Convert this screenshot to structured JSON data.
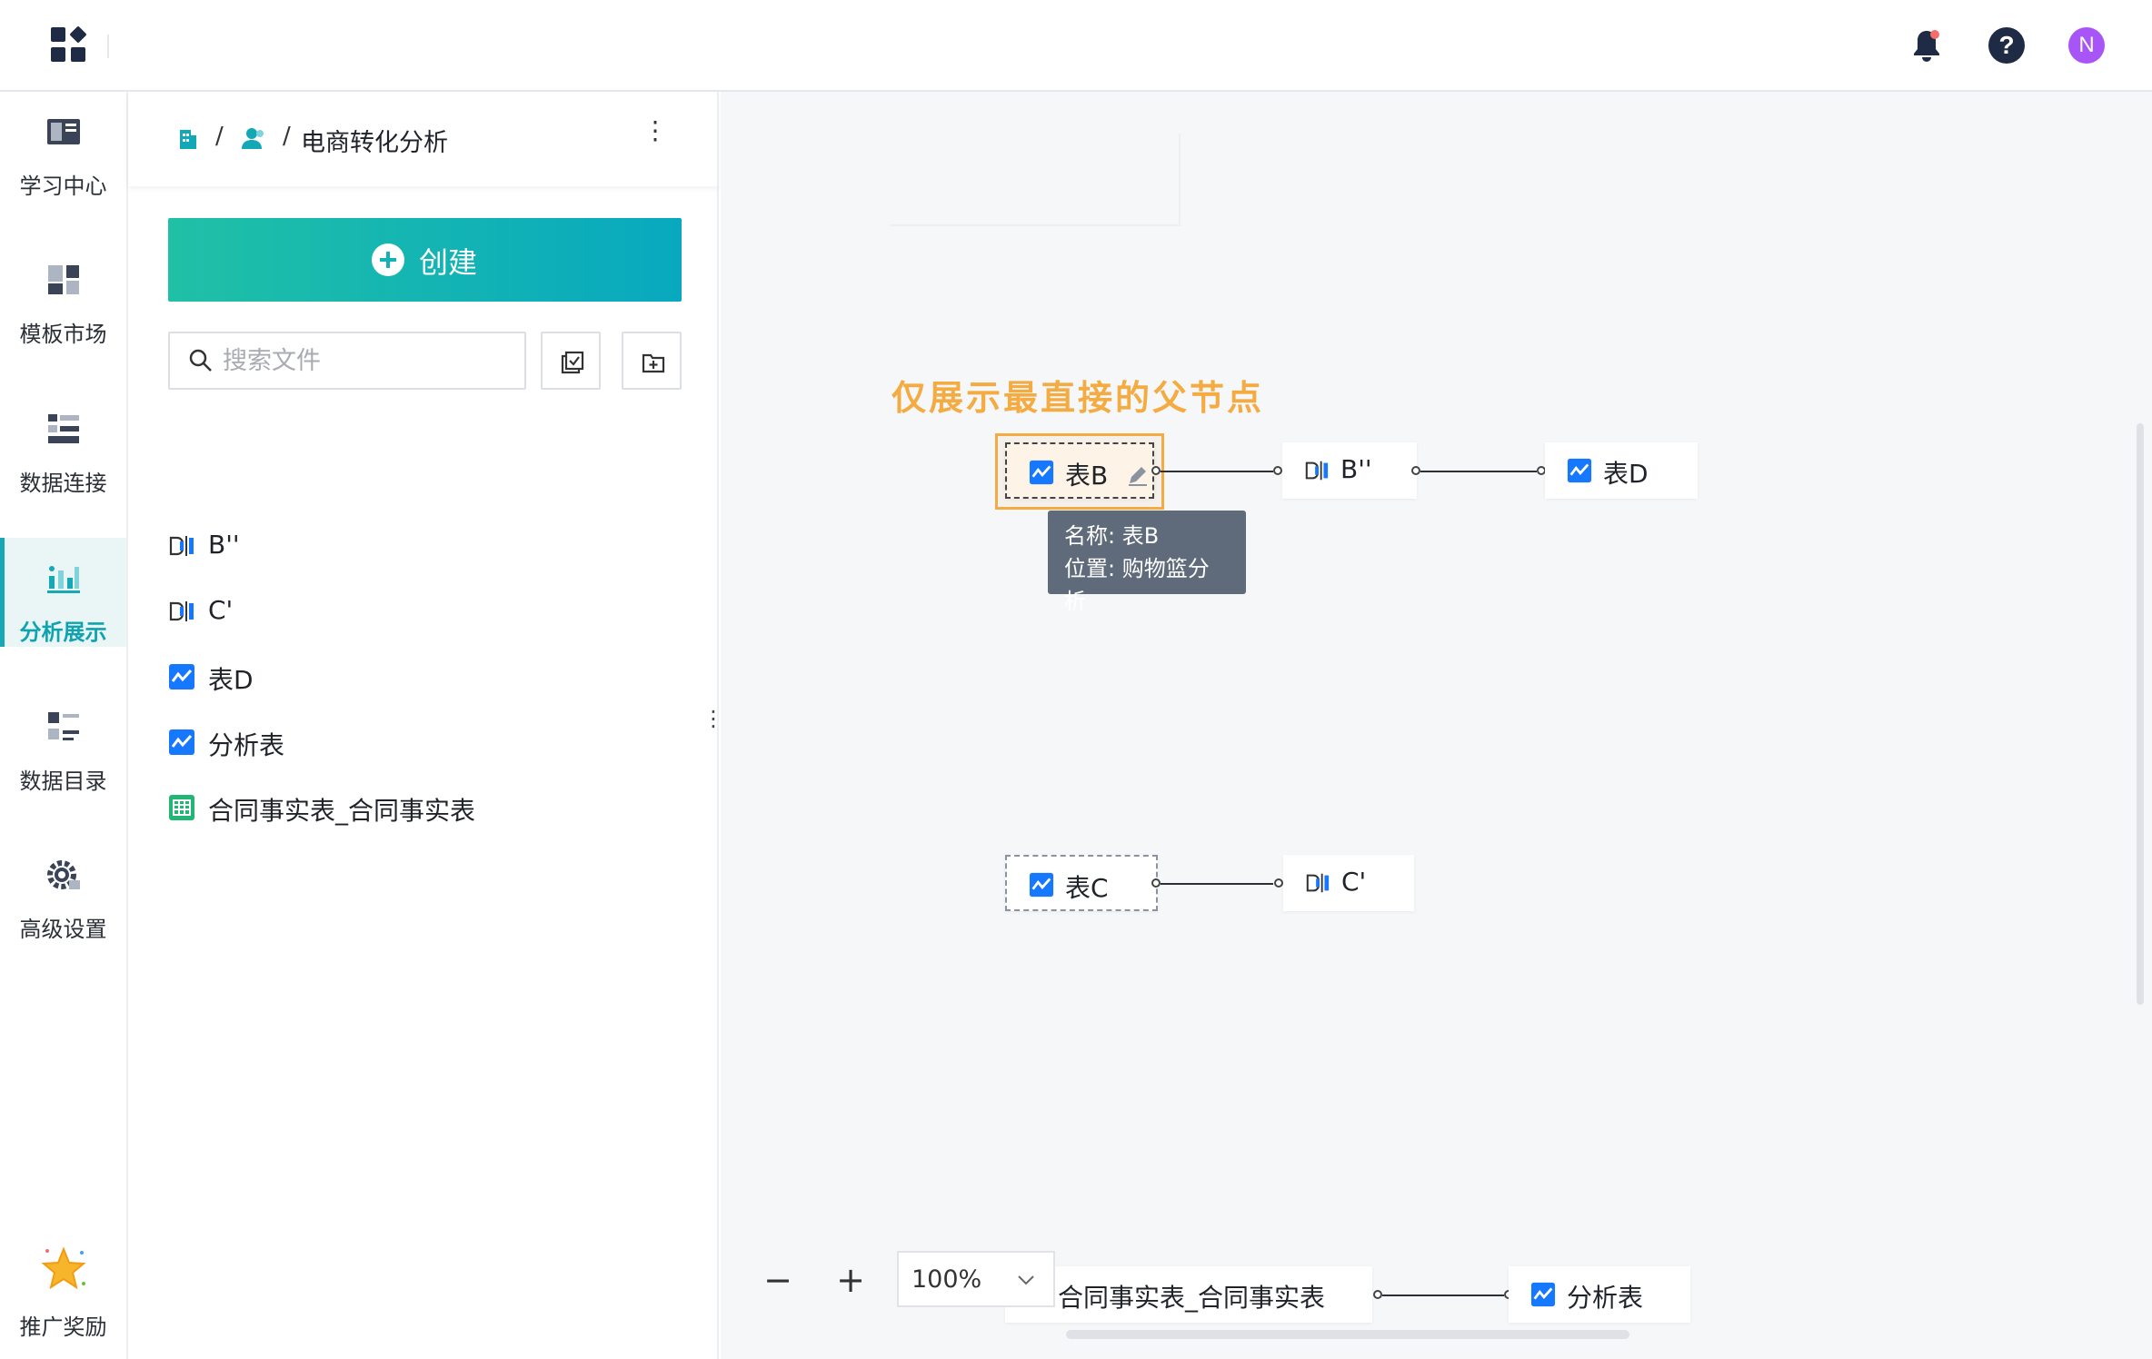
{
  "header": {
    "bell_icon": "bell-icon",
    "help_label": "?",
    "avatar_initial": "N"
  },
  "nav": {
    "items": [
      {
        "label": "学习中心",
        "icon": "book-icon"
      },
      {
        "label": "模板市场",
        "icon": "template-icon"
      },
      {
        "label": "数据连接",
        "icon": "data-connect-icon"
      },
      {
        "label": "分析展示",
        "icon": "analysis-icon",
        "active": true
      },
      {
        "label": "数据目录",
        "icon": "catalog-icon"
      },
      {
        "label": "高级设置",
        "icon": "settings-icon"
      },
      {
        "label": "推广奖励",
        "icon": "star-icon"
      }
    ]
  },
  "panel": {
    "breadcrumb": {
      "sep": "/",
      "title": "电商转化分析"
    },
    "more": "⋮",
    "create_label": "创建",
    "search_placeholder": "搜索文件",
    "files": [
      {
        "label": "B''",
        "icon": "etl-icon"
      },
      {
        "label": "C'",
        "icon": "etl-icon"
      },
      {
        "label": "表D",
        "icon": "chart-table-icon"
      },
      {
        "label": "分析表",
        "icon": "chart-table-icon"
      },
      {
        "label": "合同事实表_合同事实表",
        "icon": "sheet-icon"
      }
    ],
    "resize": "⋮"
  },
  "canvas": {
    "annotation": "仅展示最直接的父节点",
    "nodes": {
      "b": "表B",
      "b2": "B''",
      "d": "表D",
      "c": "表C",
      "c2": "C'",
      "contract": "合同事实表_合同事实表",
      "analysis": "分析表"
    },
    "tooltip": {
      "name": "名称: 表B",
      "location": "位置: 购物篮分析"
    },
    "zoom": {
      "minus": "−",
      "plus": "+",
      "value": "100%"
    }
  },
  "colors": {
    "accent": "#0fa3b1",
    "create_gradient_start": "#20c0a6",
    "create_gradient_end": "#08a9bf",
    "annotation": "#f4ac42",
    "chart_icon": "#1677ff"
  }
}
